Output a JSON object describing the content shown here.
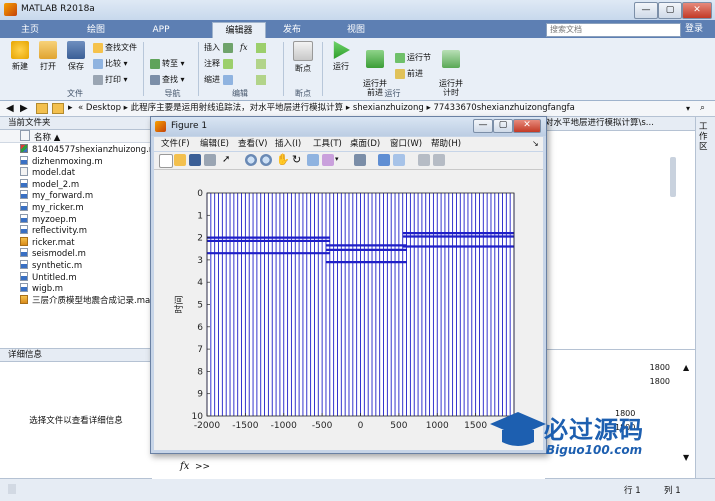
{
  "window": {
    "title": "MATLAB R2018a",
    "minimize": "—",
    "maximize": "▢",
    "close": "✕"
  },
  "tabs": [
    {
      "label": "主页"
    },
    {
      "label": "绘图"
    },
    {
      "label": "APP"
    },
    {
      "label": "编辑器"
    },
    {
      "label": "发布"
    },
    {
      "label": "视图"
    }
  ],
  "search": {
    "placeholder": "搜索文档"
  },
  "help_label": "登录",
  "ribbon": {
    "file": {
      "new": "新建",
      "open": "打开",
      "save": "保存",
      "find_files": "查找文件",
      "compare": "比较",
      "print": "打印",
      "group": "文件"
    },
    "navigate": {
      "goto": "转至",
      "find": "查找",
      "group": "导航"
    },
    "edit": {
      "insert": "插入",
      "comment": "注释",
      "indent": "缩进",
      "fx": "fx",
      "group": "编辑"
    },
    "breakpoints": {
      "label": "断点",
      "group": "断点"
    },
    "run": {
      "run": "运行",
      "run_advance": "运行并\n前进",
      "run_section": "运行节",
      "advance": "前进",
      "run_time": "运行并\n计时",
      "group": "运行"
    }
  },
  "address": {
    "parts": [
      "Desktop",
      "此程序主要是运用射线追踪法，对水平地层进行模拟计算",
      "shexianzhuizong",
      "77433670shexianzhuizongfangfa"
    ]
  },
  "folder_panel": {
    "title": "当前文件夹",
    "column_name": "名称 ▲",
    "files": [
      {
        "name": "81404577shexianzhuizong.rar",
        "type": "fig"
      },
      {
        "name": "dizhenmoxing.m",
        "type": "mfile"
      },
      {
        "name": "model.dat",
        "type": "dat"
      },
      {
        "name": "model_2.m",
        "type": "mfile"
      },
      {
        "name": "my_forward.m",
        "type": "mfile"
      },
      {
        "name": "my_ricker.m",
        "type": "mfile"
      },
      {
        "name": "myzoep.m",
        "type": "mfile"
      },
      {
        "name": "reflectivity.m",
        "type": "mfile"
      },
      {
        "name": "ricker.mat",
        "type": "mat"
      },
      {
        "name": "seismodel.m",
        "type": "mfile"
      },
      {
        "name": "synthetic.m",
        "type": "mfile"
      },
      {
        "name": "Untitled.m",
        "type": "mfile"
      },
      {
        "name": "wigb.m",
        "type": "mfile"
      },
      {
        "name": "三层介质模型地震合成记录.mat",
        "type": "mat"
      }
    ]
  },
  "detail_panel": {
    "title": "详细信息",
    "message": "选择文件以查看详细信息"
  },
  "workspace_side": {
    "label": "工作区",
    "crumb_tail": "对水平地层进行模拟计算\\s..."
  },
  "figure": {
    "title": "Figure 1",
    "menus": [
      "文件(F)",
      "编辑(E)",
      "查看(V)",
      "插入(I)",
      "工具(T)",
      "桌面(D)",
      "窗口(W)",
      "帮助(H)"
    ],
    "ylabel": "时间"
  },
  "status": {
    "row_label": "行",
    "row": "1",
    "col_label": "列",
    "col": "1"
  },
  "cmd": {
    "fx": "fx",
    "prompt": ">>"
  },
  "right_numbers": [
    "1800",
    "1800",
    "1800",
    "1800"
  ],
  "watermark": {
    "title": "必过源码",
    "url": "Biguo100.com"
  },
  "chart_data": {
    "type": "line",
    "title": "",
    "xlabel": "",
    "ylabel": "时间",
    "xlim": [
      -2000,
      2000
    ],
    "ylim": [
      0,
      10
    ],
    "y_reversed": true,
    "xticks": [
      -2000,
      -1500,
      -1000,
      -500,
      0,
      500,
      1000,
      1500
    ],
    "yticks": [
      0,
      1,
      2,
      3,
      4,
      5,
      6,
      7,
      8,
      9,
      10
    ],
    "trace_spacing": 50,
    "trace_color": "#1f1fc8",
    "reflectors": [
      {
        "x_start": -2000,
        "x_end": -400,
        "t": 2.0
      },
      {
        "x_start": -2000,
        "x_end": -400,
        "t": 2.15
      },
      {
        "x_start": -2000,
        "x_end": -400,
        "t": 2.7
      },
      {
        "x_start": -450,
        "x_end": 600,
        "t": 2.35
      },
      {
        "x_start": -450,
        "x_end": 600,
        "t": 2.55
      },
      {
        "x_start": -450,
        "x_end": 600,
        "t": 3.1
      },
      {
        "x_start": 550,
        "x_end": 2000,
        "t": 1.8
      },
      {
        "x_start": 550,
        "x_end": 2000,
        "t": 1.95
      },
      {
        "x_start": 550,
        "x_end": 2000,
        "t": 2.4
      }
    ]
  }
}
